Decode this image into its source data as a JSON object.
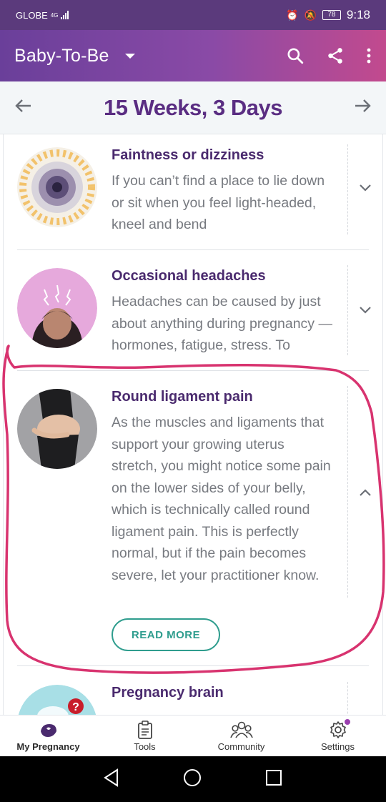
{
  "status_bar": {
    "carrier": "GLOBE",
    "network": "4G",
    "battery": "78",
    "time": "9:18"
  },
  "app_bar": {
    "title": "Baby-To-Be"
  },
  "week_header": {
    "title": "15 Weeks, 3 Days"
  },
  "symptoms": [
    {
      "title": "Faintness or dizziness",
      "body": "If you can’t find a place to lie down or sit when you feel light-headed, kneel and bend",
      "expanded": false
    },
    {
      "title": "Occasional headaches",
      "body": "Headaches can be caused by just about anything during pregnancy — hormones, fatigue, stress. To",
      "expanded": false
    },
    {
      "title": "Round ligament pain",
      "body": "As the muscles and ligaments that support your growing uterus stretch, you might notice some pain on the lower sides of your belly, which is technically called round ligament pain. This is perfectly normal, but if the pain becomes severe, let your practitioner know.",
      "expanded": true,
      "button_label": "READ MORE"
    },
    {
      "title": "Pregnancy brain",
      "body": "",
      "expanded": false
    }
  ],
  "bottom_nav": {
    "items": [
      {
        "label": "My Pregnancy",
        "icon": "pregnancy-icon",
        "active": true
      },
      {
        "label": "Tools",
        "icon": "clipboard-icon",
        "active": false
      },
      {
        "label": "Community",
        "icon": "people-icon",
        "active": false
      },
      {
        "label": "Settings",
        "icon": "gear-icon",
        "active": false
      }
    ]
  },
  "colors": {
    "status_bar": "#5b3a7c",
    "app_bar_start": "#6a3f9a",
    "app_bar_end": "#c24a8e",
    "title_purple": "#5a2d82",
    "teal_accent": "#2f9d8e",
    "annotation": "#d8336f"
  }
}
